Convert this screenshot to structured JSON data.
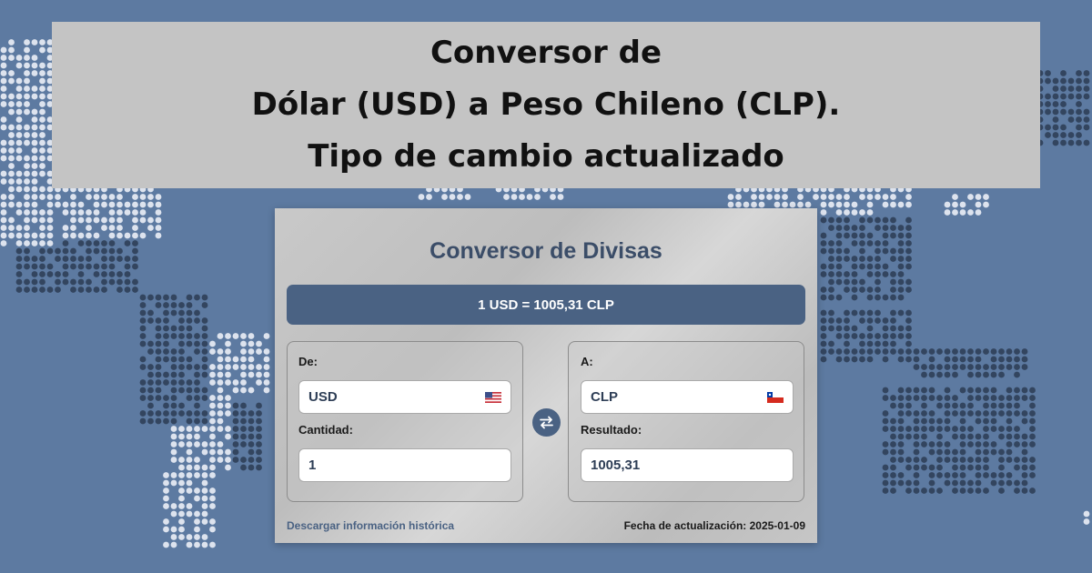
{
  "banner": {
    "line1": "Conversor de",
    "line2": "Dólar (USD) a Peso Chileno (CLP).",
    "line3": "Tipo de cambio actualizado"
  },
  "converter": {
    "title": "Conversor de Divisas",
    "rate_text": "1 USD = 1005,31 CLP",
    "from": {
      "label": "De:",
      "currency": "USD",
      "flag_icon": "us-flag-icon",
      "amount_label": "Cantidad:",
      "amount": "1"
    },
    "to": {
      "label": "A:",
      "currency": "CLP",
      "flag_icon": "chile-flag-icon",
      "result_label": "Resultado:",
      "result": "1005,31"
    },
    "swap_icon": "swap-arrows-icon",
    "download_link": "Descargar información histórica",
    "updated": "Fecha de actualización: 2025-01-09"
  },
  "colors": {
    "background": "#5d7aa1",
    "accent": "#4a6283",
    "land_light": "#dde3ee",
    "land_dark": "#33455f",
    "banner_bg": "#c4c4c4"
  }
}
